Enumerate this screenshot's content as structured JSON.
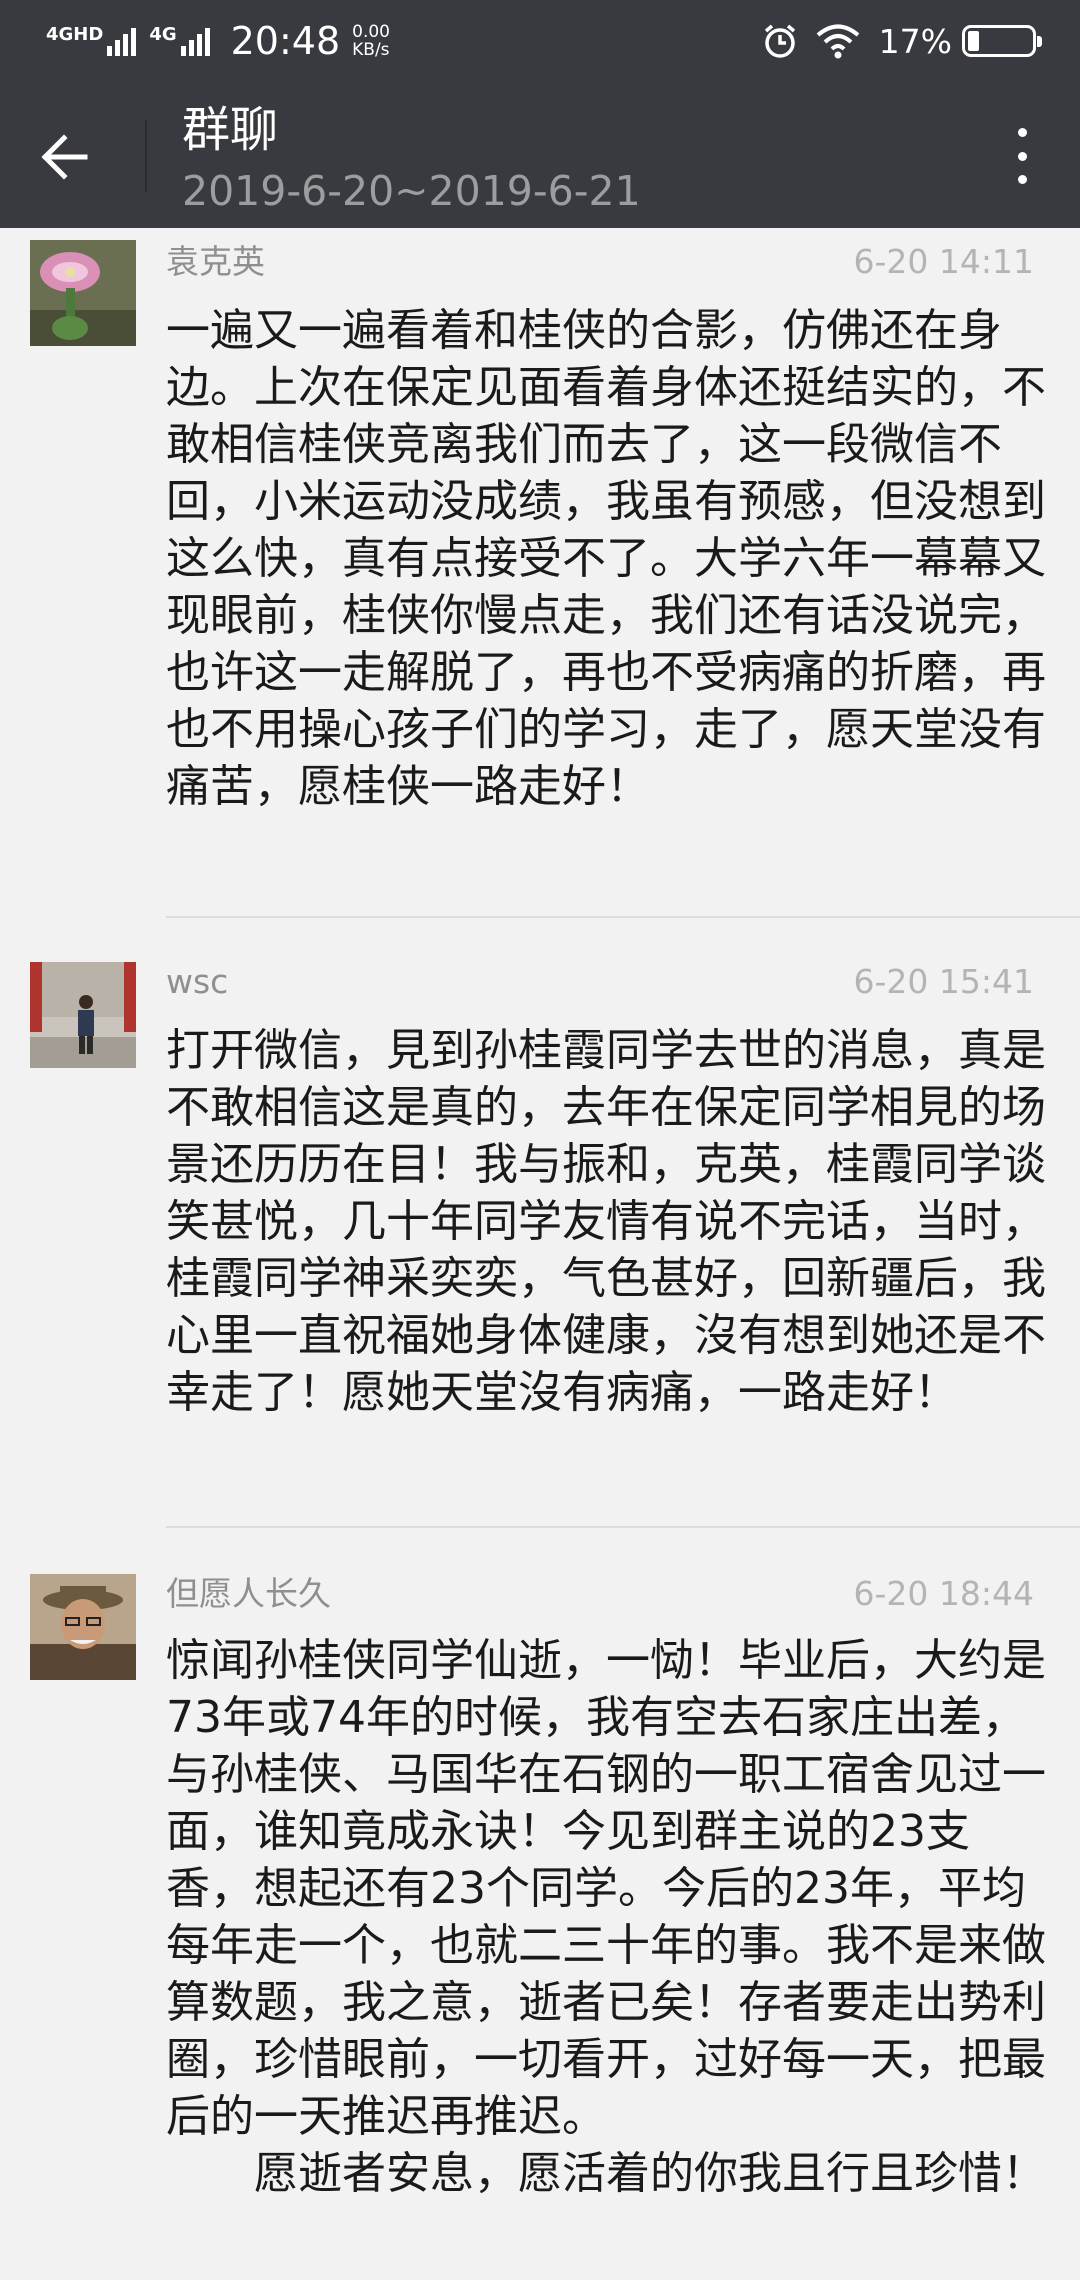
{
  "status_bar": {
    "network_1": "4GHD",
    "network_2": "4G",
    "time": "20:48",
    "speed_value": "0.00",
    "speed_unit": "KB/s",
    "battery": "17%",
    "battery_level": 0.17
  },
  "header": {
    "title": "群聊",
    "subtitle": "2019-6-20~2019-6-21",
    "back_icon": "arrow-left-icon",
    "more_icon": "more-vertical-icon"
  },
  "messages": [
    {
      "sender": "袁克英",
      "time": "6-20 14:11",
      "text": "一遍又一遍看着和桂侠的合影，仿佛还在身边。上次在保定见面看着身体还挺结实的，不敢相信桂侠竞离我们而去了，这一段微信不回，小米运动没成绩，我虽有预感，但没想到这么快，真有点接受不了。大学六年一幕幕又现眼前，桂侠你慢点走，我们还有话没说完，也许这一走解脱了，再也不受病痛的折磨，再也不用操心孩子们的学习，走了，愿天堂没有痛苦，愿桂侠一路走好！"
    },
    {
      "sender": "wsc",
      "time": "6-20 15:41",
      "text": "打开微信，見到孙桂霞同学去世的消息，真是不敢相信这是真的，去年在保定同学相見的场景还历历在目！我与振和，克英，桂霞同学谈笑甚悦，几十年同学友情有说不完话，当时，桂霞同学神采奕奕，气色甚好，回新疆后，我心里一直祝福她身体健康，沒有想到她还是不幸走了！愿她天堂沒有病痛，一路走好！"
    },
    {
      "sender": "但愿人长久",
      "time": "6-20 18:44",
      "text": "惊闻孙桂侠同学仙逝，一恸！毕业后，大约是73年或74年的时候，我有空去石家庄出差，与孙桂侠、马国华在石钢的一职工宿舍见过一面，谁知竟成永诀！今见到群主说的23支香，想起还有23个同学。今后的23年，平均每年走一个，也就二三十年的事。我不是来做算数题，我之意，逝者已矣！存者要走出势利圈，珍惜眼前，一切看开，过好每一天，把最后的一天推迟再推迟。\n　　愿逝者安息，愿活着的你我且行且珍惜！"
    }
  ]
}
